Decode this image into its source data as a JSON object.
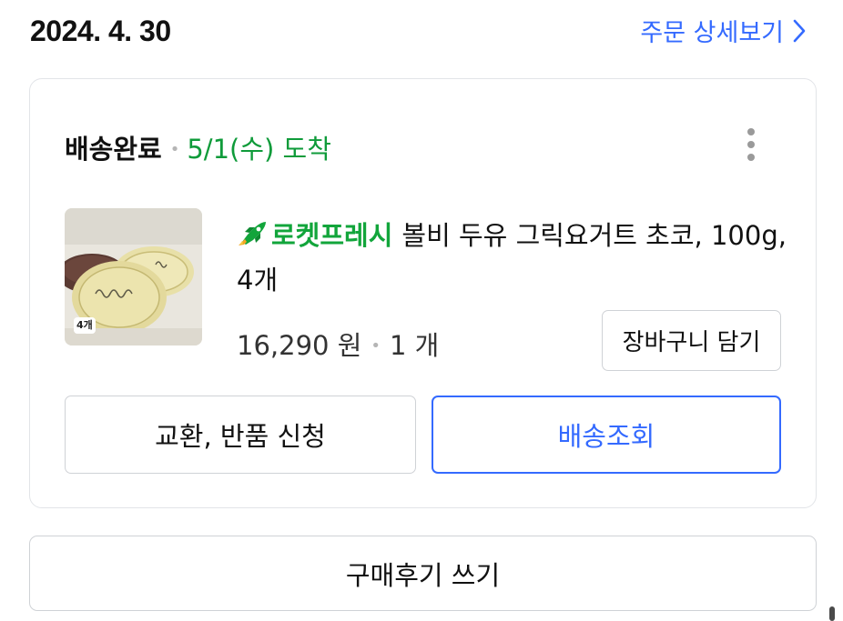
{
  "order": {
    "date": "2024. 4. 30",
    "detail_link": "주문 상세보기"
  },
  "delivery": {
    "status": "배송완료",
    "arrival": "5/1(수) 도착"
  },
  "product": {
    "badge": "4개",
    "rocket_label": "로켓프레시",
    "name": "볼비 두유 그릭요거트 초코, 100g, 4개",
    "price": "16,290 원",
    "quantity": "1 개"
  },
  "buttons": {
    "cart": "장바구니 담기",
    "exchange": "교환, 반품 신청",
    "track": "배송조회",
    "review": "구매후기 쓰기"
  },
  "colors": {
    "accent": "#346aff",
    "arrival_green": "#0f9b3a",
    "rocket_green": "#12a53b"
  }
}
